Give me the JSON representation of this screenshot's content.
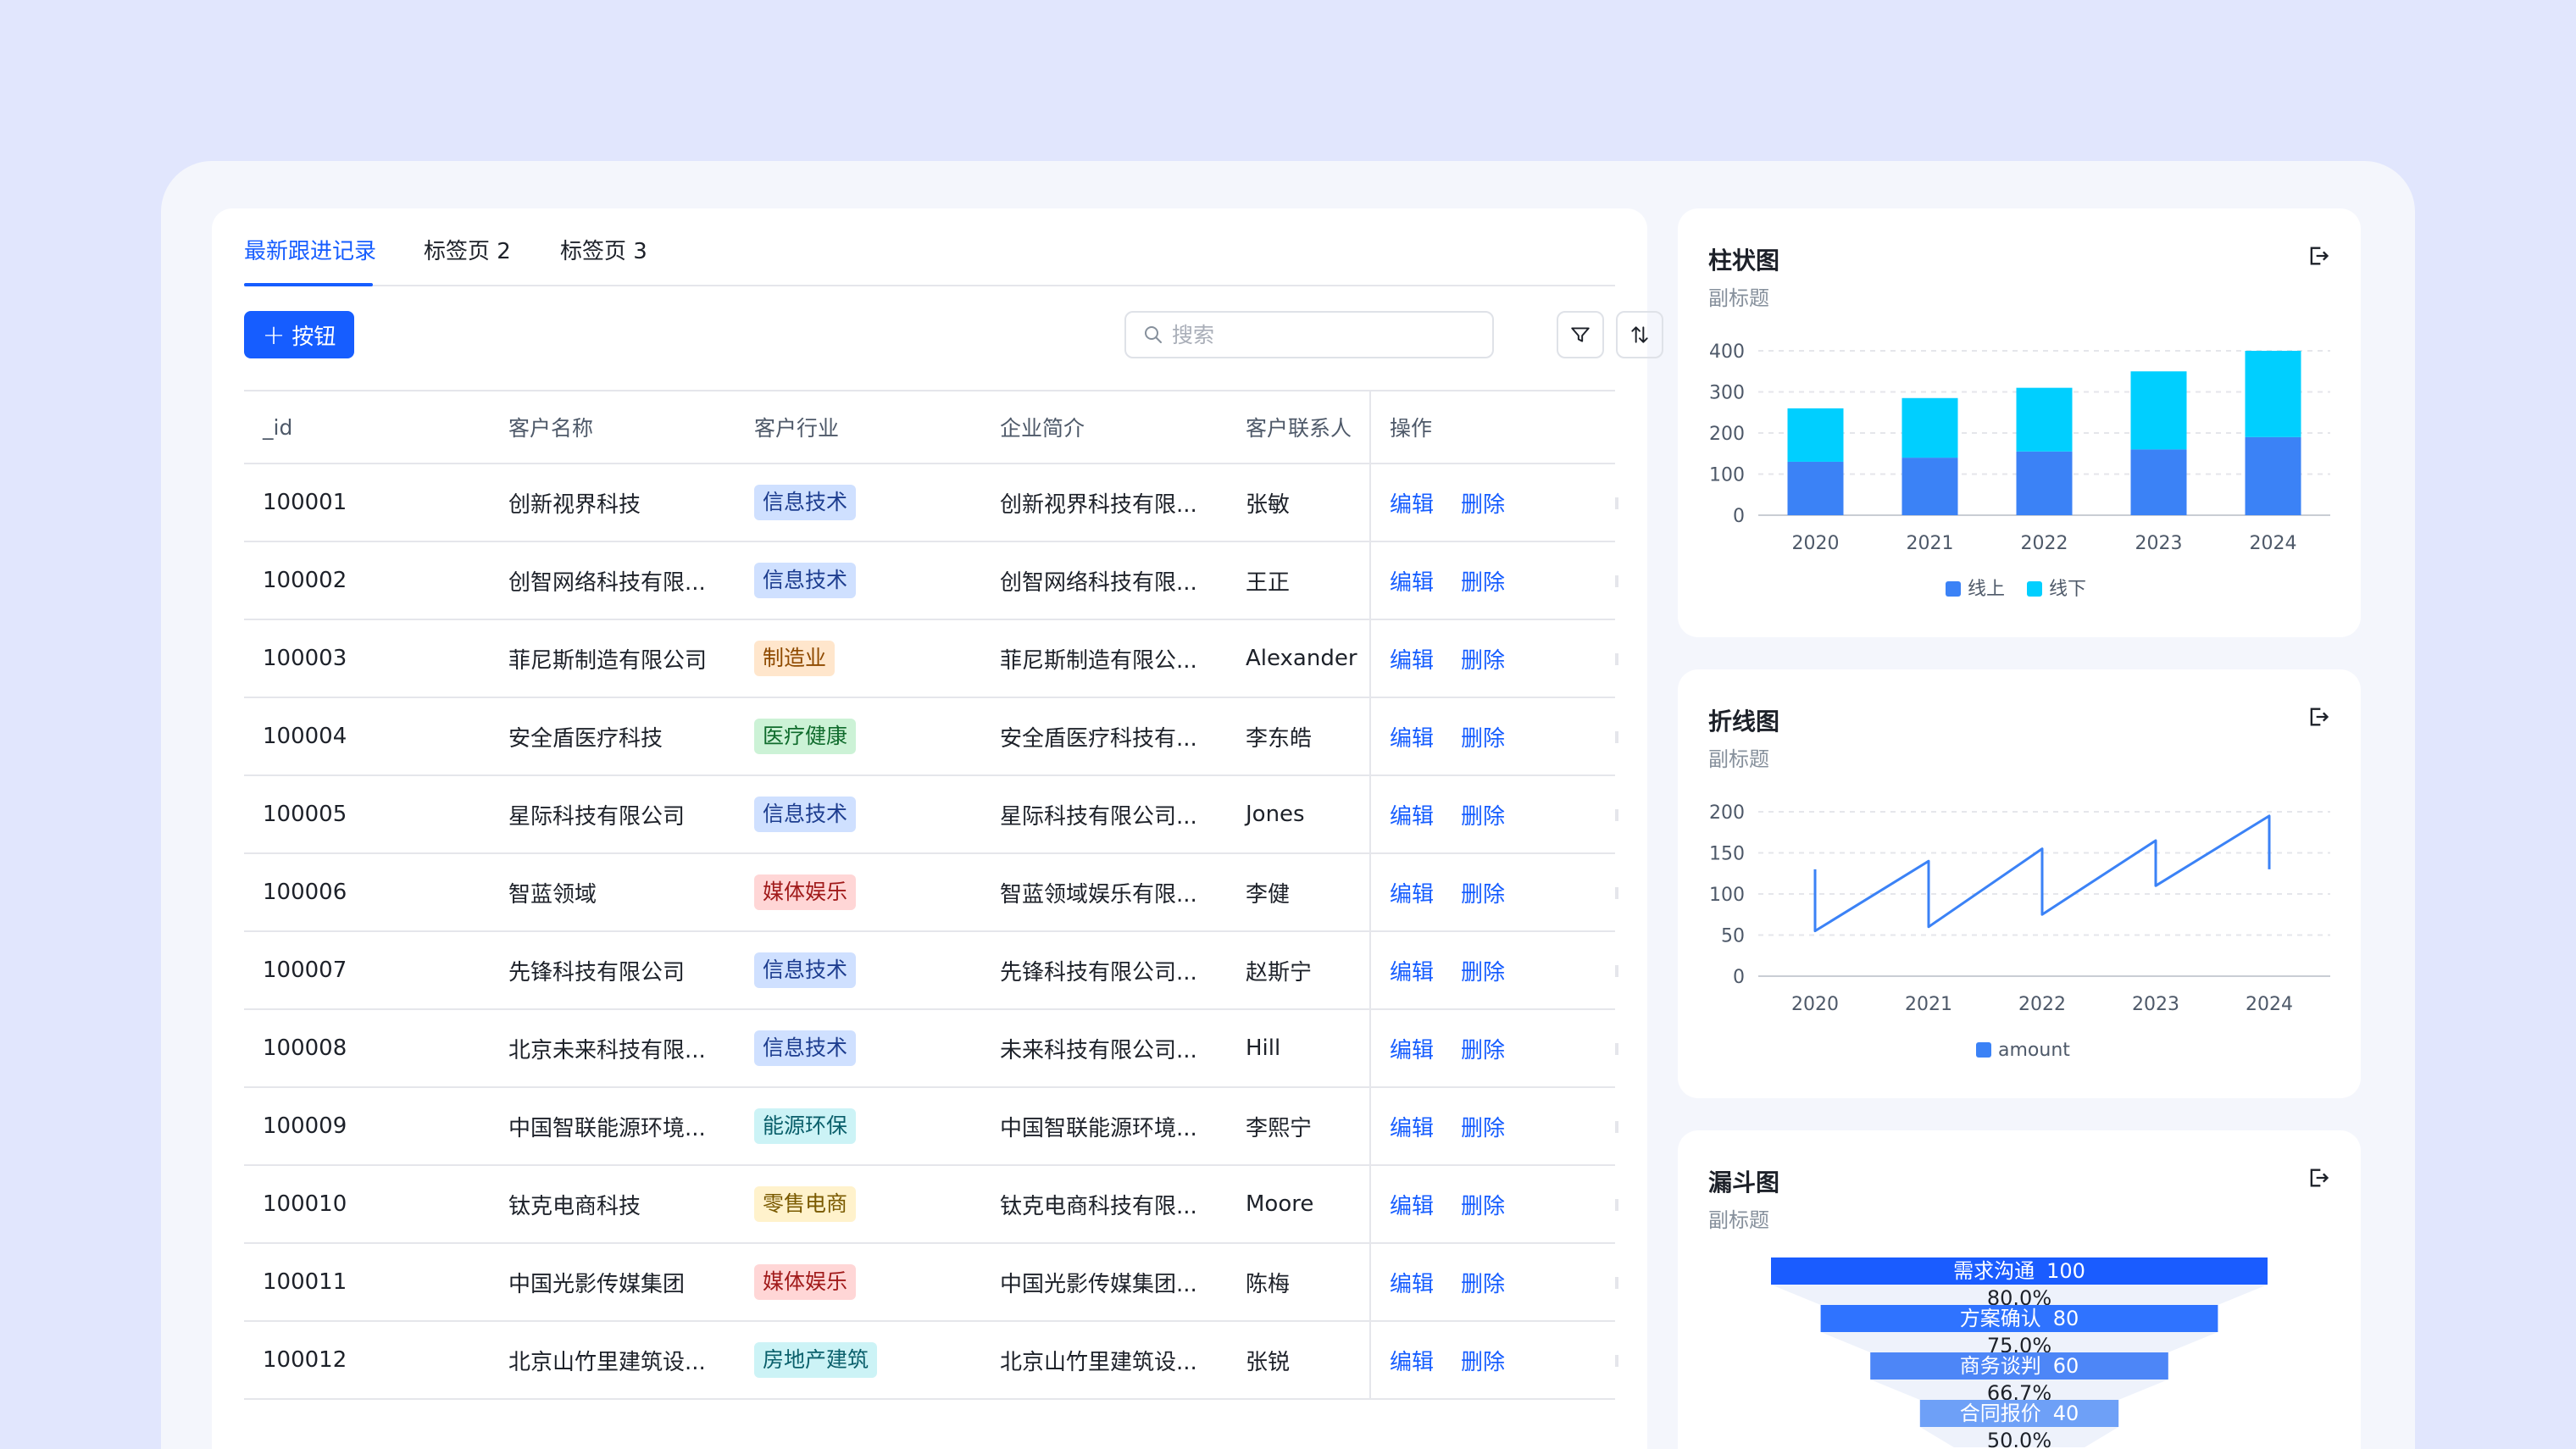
{
  "tabs": [
    "最新跟进记录",
    "标签页 2",
    "标签页 3"
  ],
  "toolbar": {
    "add_label": "按钮",
    "search_placeholder": "搜索"
  },
  "table": {
    "columns": [
      "_id",
      "客户名称",
      "客户行业",
      "企业简介",
      "客户联系人",
      "操作"
    ],
    "edit_label": "编辑",
    "delete_label": "删除",
    "rows": [
      {
        "id": "100001",
        "name": "创新视界科技",
        "industry": "信息技术",
        "tag": "blue",
        "desc": "创新视界科技有限...",
        "contact": "张敏"
      },
      {
        "id": "100002",
        "name": "创智网络科技有限...",
        "industry": "信息技术",
        "tag": "blue",
        "desc": "创智网络科技有限...",
        "contact": "王正"
      },
      {
        "id": "100003",
        "name": "菲尼斯制造有限公司",
        "industry": "制造业",
        "tag": "orange",
        "desc": "菲尼斯制造有限公...",
        "contact": "Alexander"
      },
      {
        "id": "100004",
        "name": "安全盾医疗科技",
        "industry": "医疗健康",
        "tag": "green",
        "desc": "安全盾医疗科技有...",
        "contact": "李东皓"
      },
      {
        "id": "100005",
        "name": "星际科技有限公司",
        "industry": "信息技术",
        "tag": "blue",
        "desc": "星际科技有限公司...",
        "contact": "Jones"
      },
      {
        "id": "100006",
        "name": "智蓝领域",
        "industry": "媒体娱乐",
        "tag": "red",
        "desc": "智蓝领域娱乐有限...",
        "contact": "李健"
      },
      {
        "id": "100007",
        "name": "先锋科技有限公司",
        "industry": "信息技术",
        "tag": "blue",
        "desc": "先锋科技有限公司...",
        "contact": "赵斯宁"
      },
      {
        "id": "100008",
        "name": "北京未来科技有限...",
        "industry": "信息技术",
        "tag": "blue",
        "desc": "未来科技有限公司...",
        "contact": "Hill"
      },
      {
        "id": "100009",
        "name": "中国智联能源环境...",
        "industry": "能源环保",
        "tag": "cyan",
        "desc": "中国智联能源环境...",
        "contact": "李熙宁"
      },
      {
        "id": "100010",
        "name": "钛克电商科技",
        "industry": "零售电商",
        "tag": "yellow",
        "desc": "钛克电商科技有限...",
        "contact": "Moore"
      },
      {
        "id": "100011",
        "name": "中国光影传媒集团",
        "industry": "媒体娱乐",
        "tag": "red",
        "desc": "中国光影传媒集团...",
        "contact": "陈梅"
      },
      {
        "id": "100012",
        "name": "北京山竹里建筑设...",
        "industry": "房地产建筑",
        "tag": "cyan",
        "desc": "北京山竹里建筑设...",
        "contact": "张锐"
      }
    ]
  },
  "cards": {
    "bar": {
      "title": "柱状图",
      "subtitle": "副标题"
    },
    "line": {
      "title": "折线图",
      "subtitle": "副标题"
    },
    "funnel": {
      "title": "漏斗图",
      "subtitle": "副标题"
    }
  },
  "colors": {
    "accent": "#165dff",
    "bar_online": "#3b82f6",
    "bar_offline": "#00cfff",
    "line": "#3b82f6"
  },
  "chart_data": [
    {
      "type": "bar",
      "stacked": true,
      "categories": [
        "2020",
        "2021",
        "2022",
        "2023",
        "2024"
      ],
      "series": [
        {
          "name": "线上",
          "values": [
            130,
            140,
            155,
            160,
            190
          ]
        },
        {
          "name": "线下",
          "values": [
            130,
            145,
            155,
            190,
            210
          ]
        }
      ],
      "ylim": [
        0,
        400
      ],
      "yticks": [
        0,
        100,
        200,
        300,
        400
      ],
      "legend": "bottom"
    },
    {
      "type": "line",
      "categories": [
        "2020",
        "2021",
        "2022",
        "2023",
        "2024"
      ],
      "series": [
        {
          "name": "amount",
          "points": [
            [
              0,
              130
            ],
            [
              0,
              55
            ],
            [
              1,
              140
            ],
            [
              1,
              60
            ],
            [
              2,
              155
            ],
            [
              2,
              75
            ],
            [
              3,
              165
            ],
            [
              3,
              110
            ],
            [
              4,
              195
            ],
            [
              4,
              130
            ]
          ]
        }
      ],
      "ylim": [
        0,
        200
      ],
      "yticks": [
        0,
        50,
        100,
        150,
        200
      ],
      "legend": "bottom"
    },
    {
      "type": "funnel",
      "stages": [
        {
          "name": "需求沟通",
          "value": 100
        },
        {
          "name": "方案确认",
          "value": 80
        },
        {
          "name": "商务谈判",
          "value": 60
        },
        {
          "name": "合同报价",
          "value": 40
        }
      ],
      "conversion": [
        "80.0%",
        "75.0%",
        "66.7%",
        "50.0%"
      ]
    }
  ]
}
